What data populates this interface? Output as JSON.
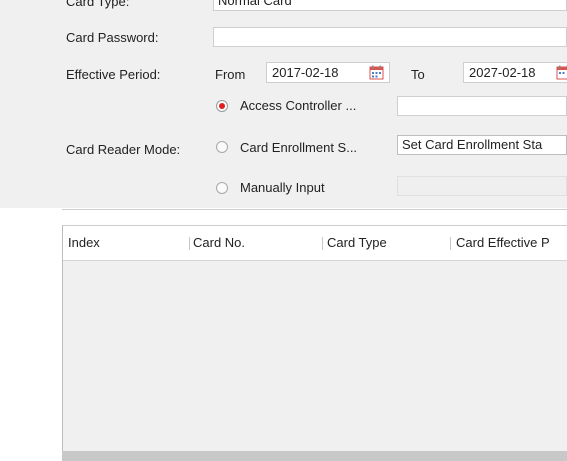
{
  "form": {
    "card_type": {
      "label": "Card Type:",
      "value": "Normal Card"
    },
    "card_password": {
      "label": "Card Password:",
      "value": ""
    },
    "effective_period": {
      "label": "Effective Period:",
      "from_label": "From",
      "from_date": "2017-02-18",
      "to_label": "To",
      "to_date": "2027-02-18"
    },
    "card_reader_mode": {
      "label": "Card Reader Mode:",
      "options": [
        {
          "label": "Access Controller ...",
          "selected": true,
          "field_value": ""
        },
        {
          "label": "Card Enrollment S...",
          "selected": false,
          "field_value": "Set Card Enrollment Sta"
        },
        {
          "label": "Manually Input",
          "selected": false,
          "field_value": ""
        }
      ]
    }
  },
  "table": {
    "columns": [
      "Index",
      "Card No.",
      "Card Type",
      "Card Effective P"
    ],
    "rows": []
  },
  "icons": {
    "calendar": "calendar-icon",
    "radio": "radio-button"
  },
  "colors": {
    "panel_bg": "#f0f0f0",
    "radio_selected": "#e02020",
    "calendar_accent": "#d9534f"
  }
}
